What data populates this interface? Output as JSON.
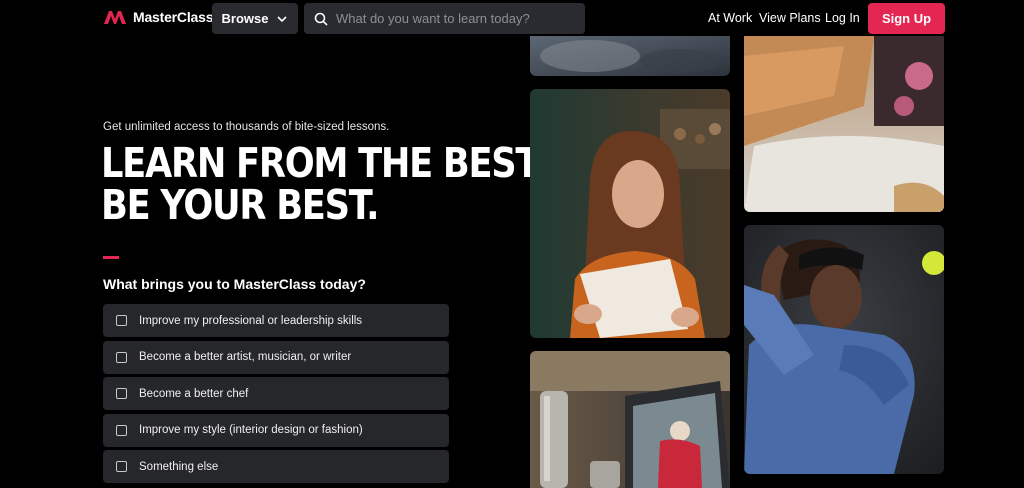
{
  "header": {
    "brand": "MasterClass",
    "browse_label": "Browse",
    "search_placeholder": "What do you want to learn today?",
    "links": [
      "At Work",
      "View Plans",
      "Log In"
    ],
    "signup_label": "Sign Up"
  },
  "hero": {
    "eyebrow": "Get unlimited access to thousands of bite-sized lessons.",
    "headline_line1": "LEARN FROM THE BEST,",
    "headline_line2": "BE YOUR BEST.",
    "question": "What brings you to MasterClass today?",
    "options": [
      "Improve my professional or leadership skills",
      "Become a better artist, musician, or writer",
      "Become a better chef",
      "Improve my style (interior design or fashion)",
      "Something else"
    ]
  },
  "colors": {
    "accent": "#e32652",
    "background": "#000000",
    "panel": "#26272b"
  }
}
